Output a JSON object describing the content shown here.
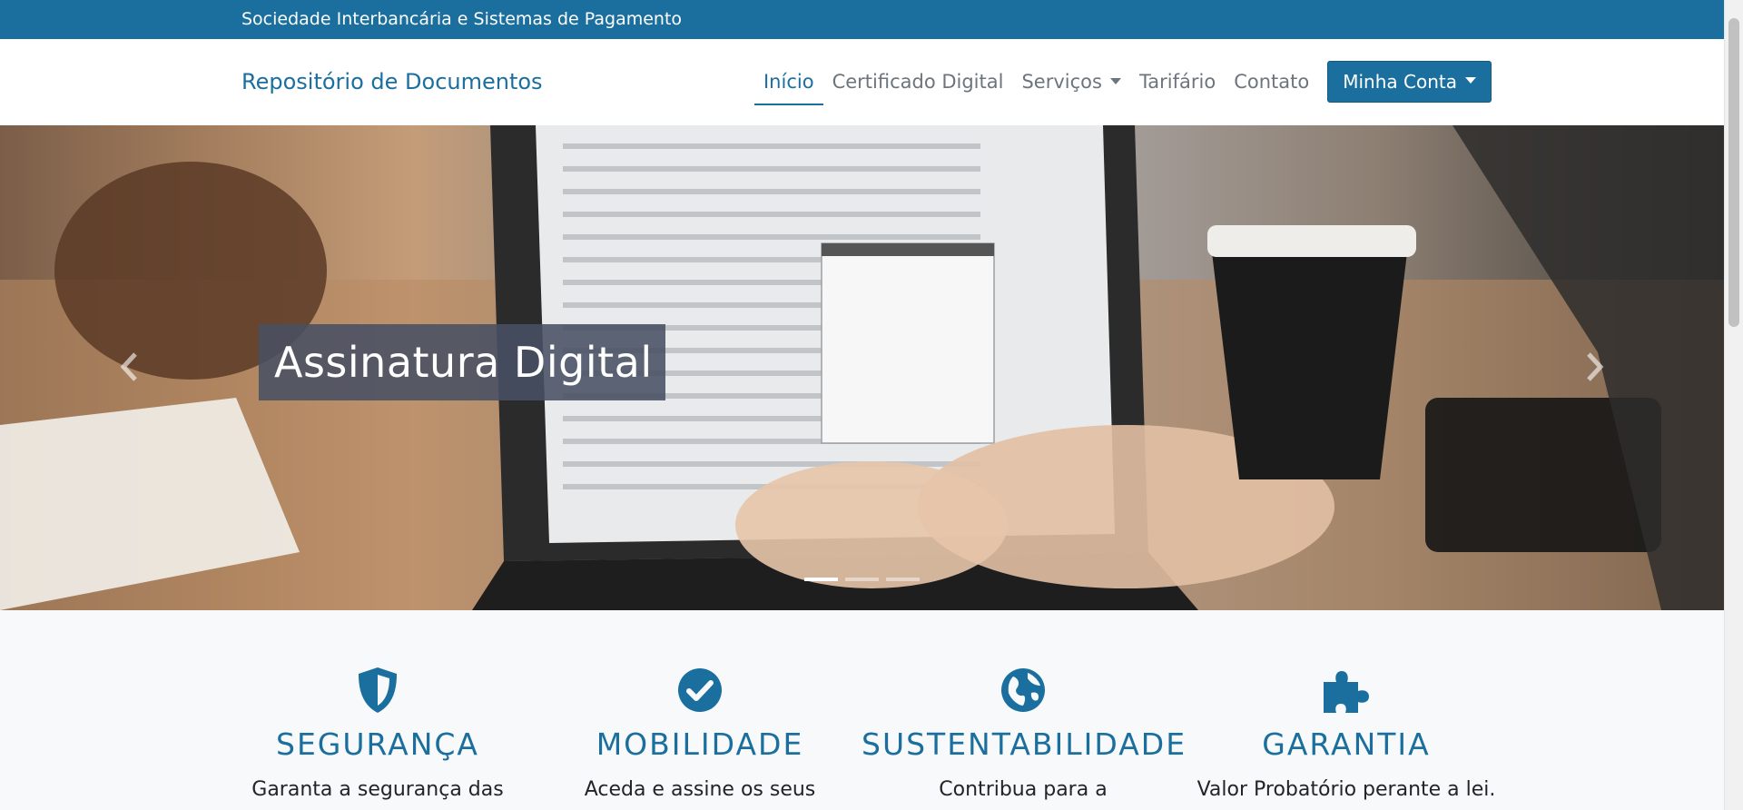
{
  "topbar": {
    "text": "Sociedade Interbancária e Sistemas de Pagamento"
  },
  "brand": "Repositório de Documentos",
  "nav": {
    "items": [
      {
        "label": "Início",
        "active": true
      },
      {
        "label": "Certificado Digital"
      },
      {
        "label": "Serviços",
        "dropdown": true
      },
      {
        "label": "Tarifário"
      },
      {
        "label": "Contato"
      }
    ],
    "account": "Minha Conta"
  },
  "hero": {
    "caption": "Assinatura Digital",
    "slides": 3,
    "active_slide": 1,
    "prev_icon": "chevron-left-icon",
    "next_icon": "chevron-right-icon"
  },
  "features": [
    {
      "icon": "shield-icon",
      "title": "SEGURANÇA",
      "desc": "Garanta a segurança das"
    },
    {
      "icon": "check-circle-icon",
      "title": "MOBILIDADE",
      "desc": "Aceda e assine os seus"
    },
    {
      "icon": "globe-icon",
      "title": "SUSTENTABILIDADE",
      "desc": "Contribua para a"
    },
    {
      "icon": "puzzle-icon",
      "title": "GARANTIA",
      "desc": "Valor Probatório perante a lei."
    }
  ],
  "colors": {
    "primary": "#1b6f9e",
    "caption_bg": "#485063",
    "muted": "#6c757d",
    "section_bg": "#f8f9fa"
  }
}
